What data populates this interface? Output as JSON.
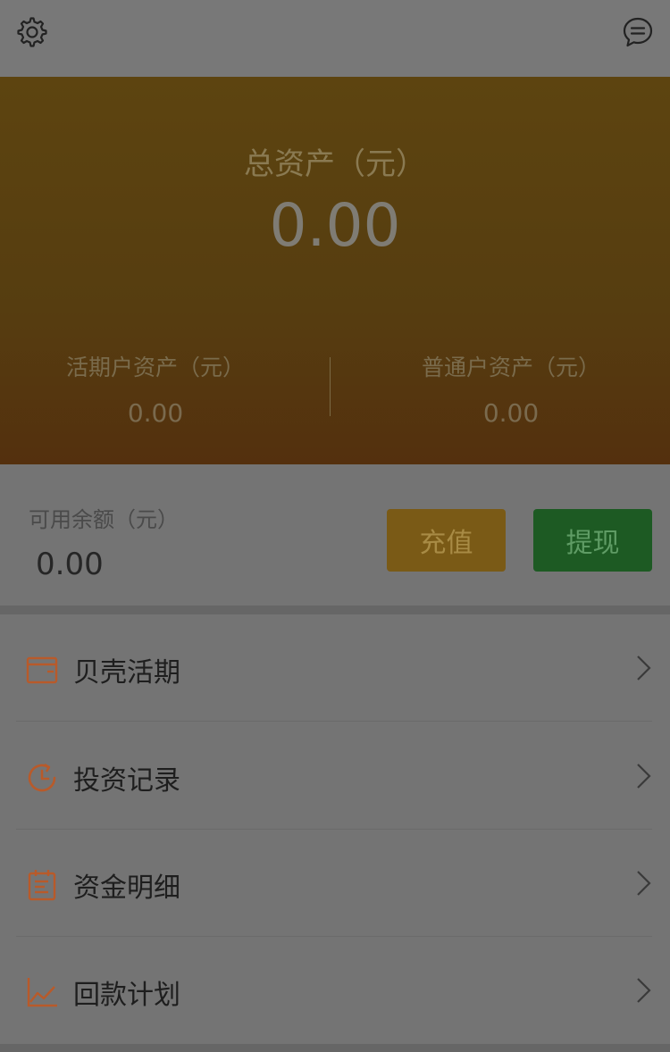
{
  "header": {
    "settings_icon": "gear-icon",
    "message_icon": "chat-bubble-icon"
  },
  "assets": {
    "total_label": "总资产（元）",
    "total_value": "0.00",
    "current_label": "活期户资产（元）",
    "current_value": "0.00",
    "regular_label": "普通户资产（元）",
    "regular_value": "0.00"
  },
  "balance": {
    "label": "可用余额（元）",
    "value": "0.00",
    "recharge_label": "充值",
    "withdraw_label": "提现"
  },
  "menu": {
    "items": [
      {
        "label": "贝壳活期",
        "icon": "wallet-icon"
      },
      {
        "label": "投资记录",
        "icon": "clock-refresh-icon"
      },
      {
        "label": "资金明细",
        "icon": "clipboard-list-icon"
      },
      {
        "label": "回款计划",
        "icon": "line-chart-icon"
      }
    ]
  },
  "colors": {
    "accent_orange": "#b85a2a",
    "recharge_bg": "#7a5a16",
    "withdraw_bg": "#1d5a23"
  }
}
